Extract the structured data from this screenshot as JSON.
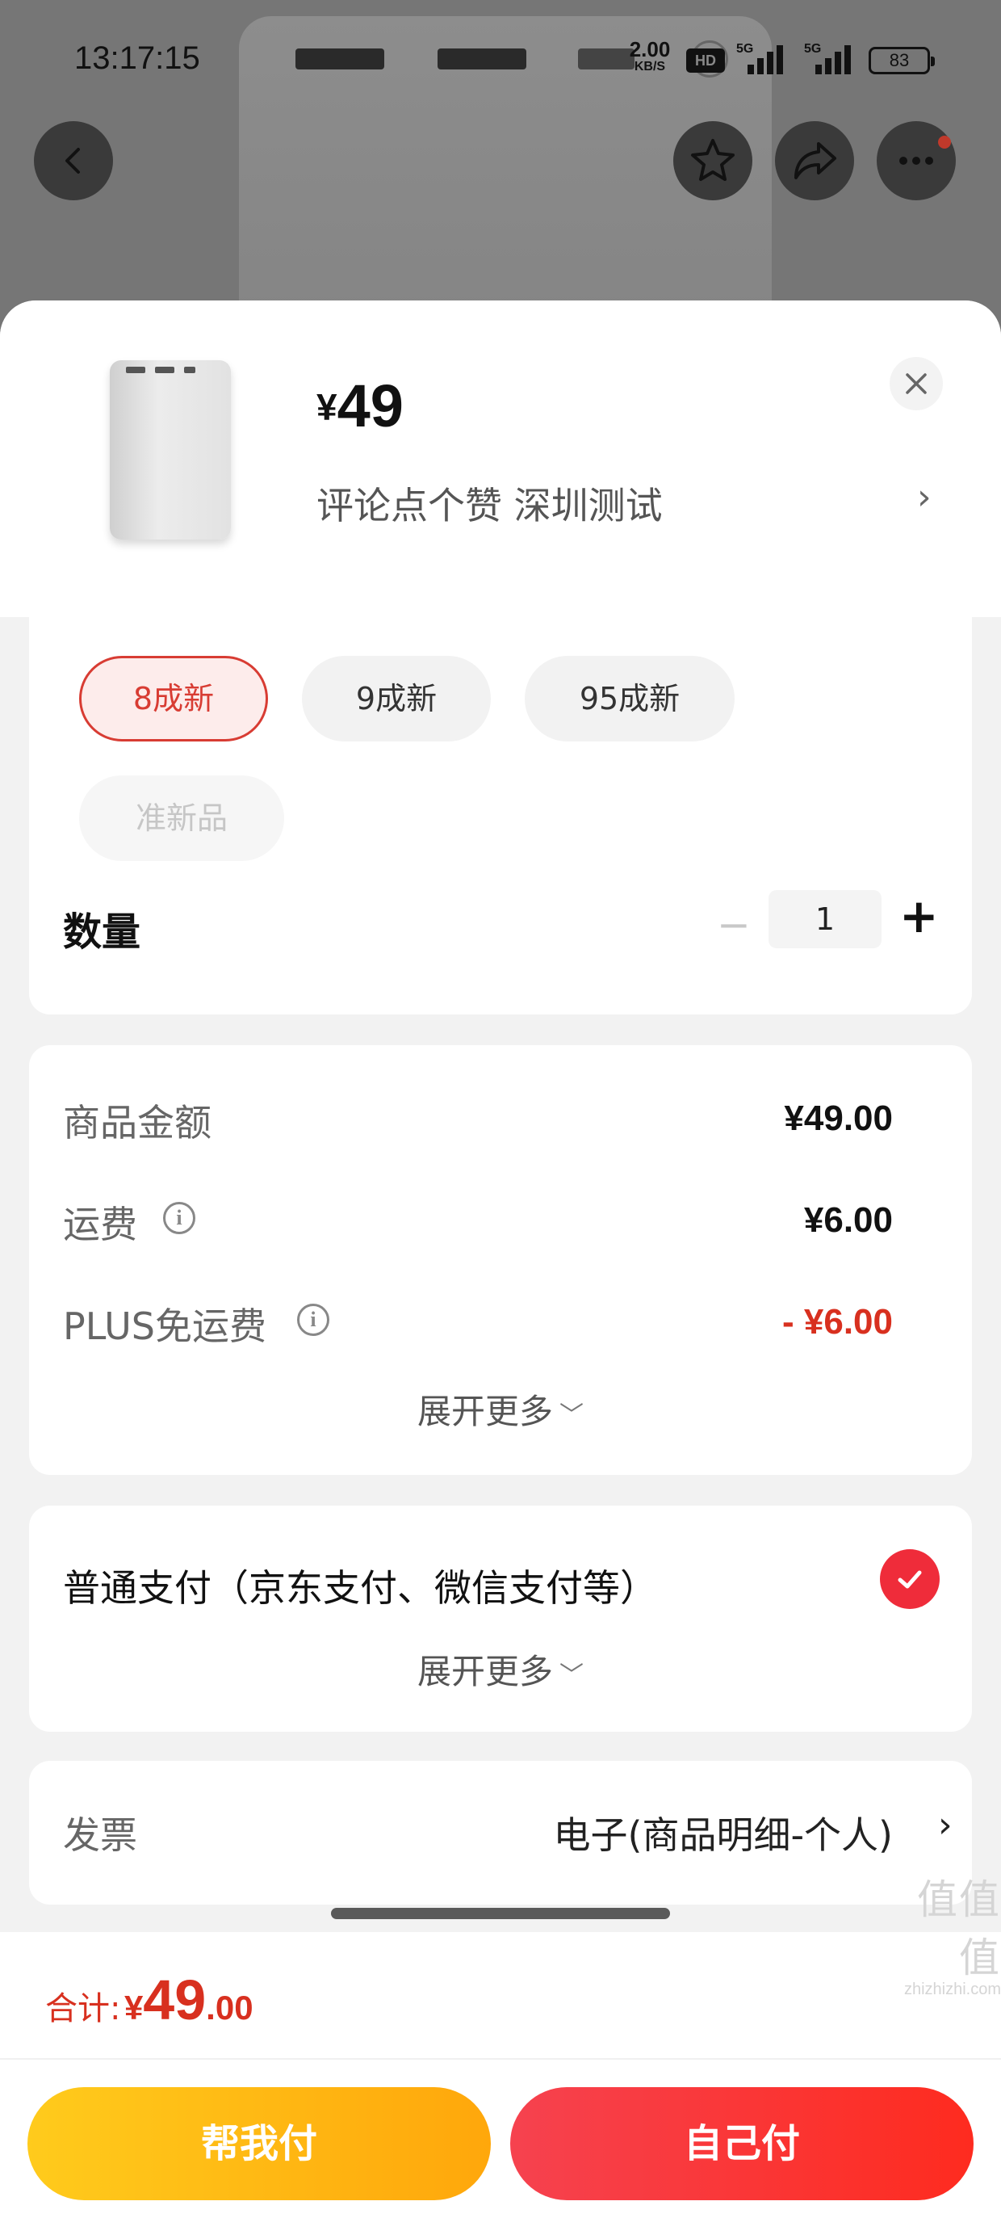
{
  "status_bar": {
    "time": "13:17:15",
    "net_speed_value": "2.00",
    "net_speed_unit": "KB/S",
    "hd_label": "HD",
    "signal_1_tag": "5G",
    "signal_2_tag": "5G",
    "battery": "83"
  },
  "top_nav": {
    "back_icon": "chevron-left-icon",
    "favorite_icon": "star-icon",
    "share_icon": "share-icon",
    "more_icon": "more-dots-icon"
  },
  "product": {
    "price_currency": "¥",
    "price": "49",
    "subtitle": "评论点个赞  深圳测试",
    "subtitle_chevron": "›",
    "close_icon": "close-icon"
  },
  "condition_options": [
    {
      "label": "8成新",
      "state": "selected"
    },
    {
      "label": "9成新",
      "state": "normal"
    },
    {
      "label": "95成新",
      "state": "normal"
    },
    {
      "label": "准新品",
      "state": "disabled"
    }
  ],
  "quantity": {
    "label": "数量",
    "minus": "−",
    "value": "1",
    "plus": "+"
  },
  "cost": {
    "goods_label": "商品金额",
    "goods_value": "¥49.00",
    "shipping_label": "运费",
    "shipping_value": "¥6.00",
    "plus_label": "PLUS免运费",
    "plus_value": "- ¥6.00",
    "expand_label": "展开更多",
    "expand_chevron": "﹀"
  },
  "payment": {
    "method_label": "普通支付（京东支付、微信支付等）",
    "expand_label": "展开更多",
    "expand_chevron": "﹀"
  },
  "invoice": {
    "label": "发票",
    "value": "电子(商品明细-个人)",
    "chevron": "›"
  },
  "footer": {
    "total_label": "合计:",
    "total_currency": "¥",
    "total_int": "49",
    "total_dec": ".00",
    "btn_friend": "帮我付",
    "btn_self": "自己付"
  },
  "watermark": {
    "big": "值值值",
    "small": "zhizhizhi.com"
  },
  "colors": {
    "accent_red": "#d8301f",
    "pay_yellow": "#ffb50f",
    "pay_red": "#f5333e"
  }
}
